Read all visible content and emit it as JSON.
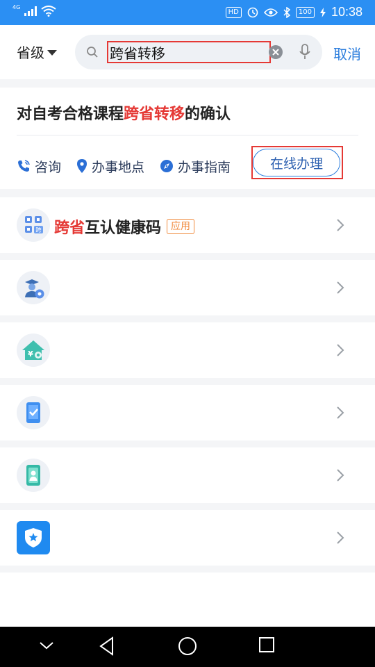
{
  "status_bar": {
    "network": "4G",
    "battery": "100",
    "time": "10:38"
  },
  "search_bar": {
    "province_label": "省级",
    "query": "跨省转移",
    "cancel_label": "取消"
  },
  "result_card": {
    "title_before": "对自考合格课程",
    "title_highlight": "跨省转移",
    "title_after": "的确认",
    "actions": [
      {
        "label": "咨询",
        "icon": "phone-icon"
      },
      {
        "label": "办事地点",
        "icon": "location-pin-icon"
      },
      {
        "label": "办事指南",
        "icon": "compass-icon"
      }
    ],
    "online_button_label": "在线办理"
  },
  "list_items": [
    {
      "highlight": "跨省",
      "label": "互认健康码",
      "tag": "应用",
      "icon": "health-code-icon"
    },
    {
      "highlight": "",
      "label": "",
      "tag": "",
      "icon": "graduate-settings-icon"
    },
    {
      "highlight": "",
      "label": "",
      "tag": "",
      "icon": "house-yuan-icon"
    },
    {
      "highlight": "",
      "label": "",
      "tag": "",
      "icon": "phone-check-icon"
    },
    {
      "highlight": "",
      "label": "",
      "tag": "",
      "icon": "id-card-icon"
    },
    {
      "highlight": "",
      "label": "",
      "tag": "",
      "icon": "police-badge-icon"
    }
  ],
  "colors": {
    "status_bar": "#2b8ff3",
    "accent": "#2b7ddd",
    "highlight_red": "#e53935",
    "tag_orange": "#f08a3c"
  }
}
